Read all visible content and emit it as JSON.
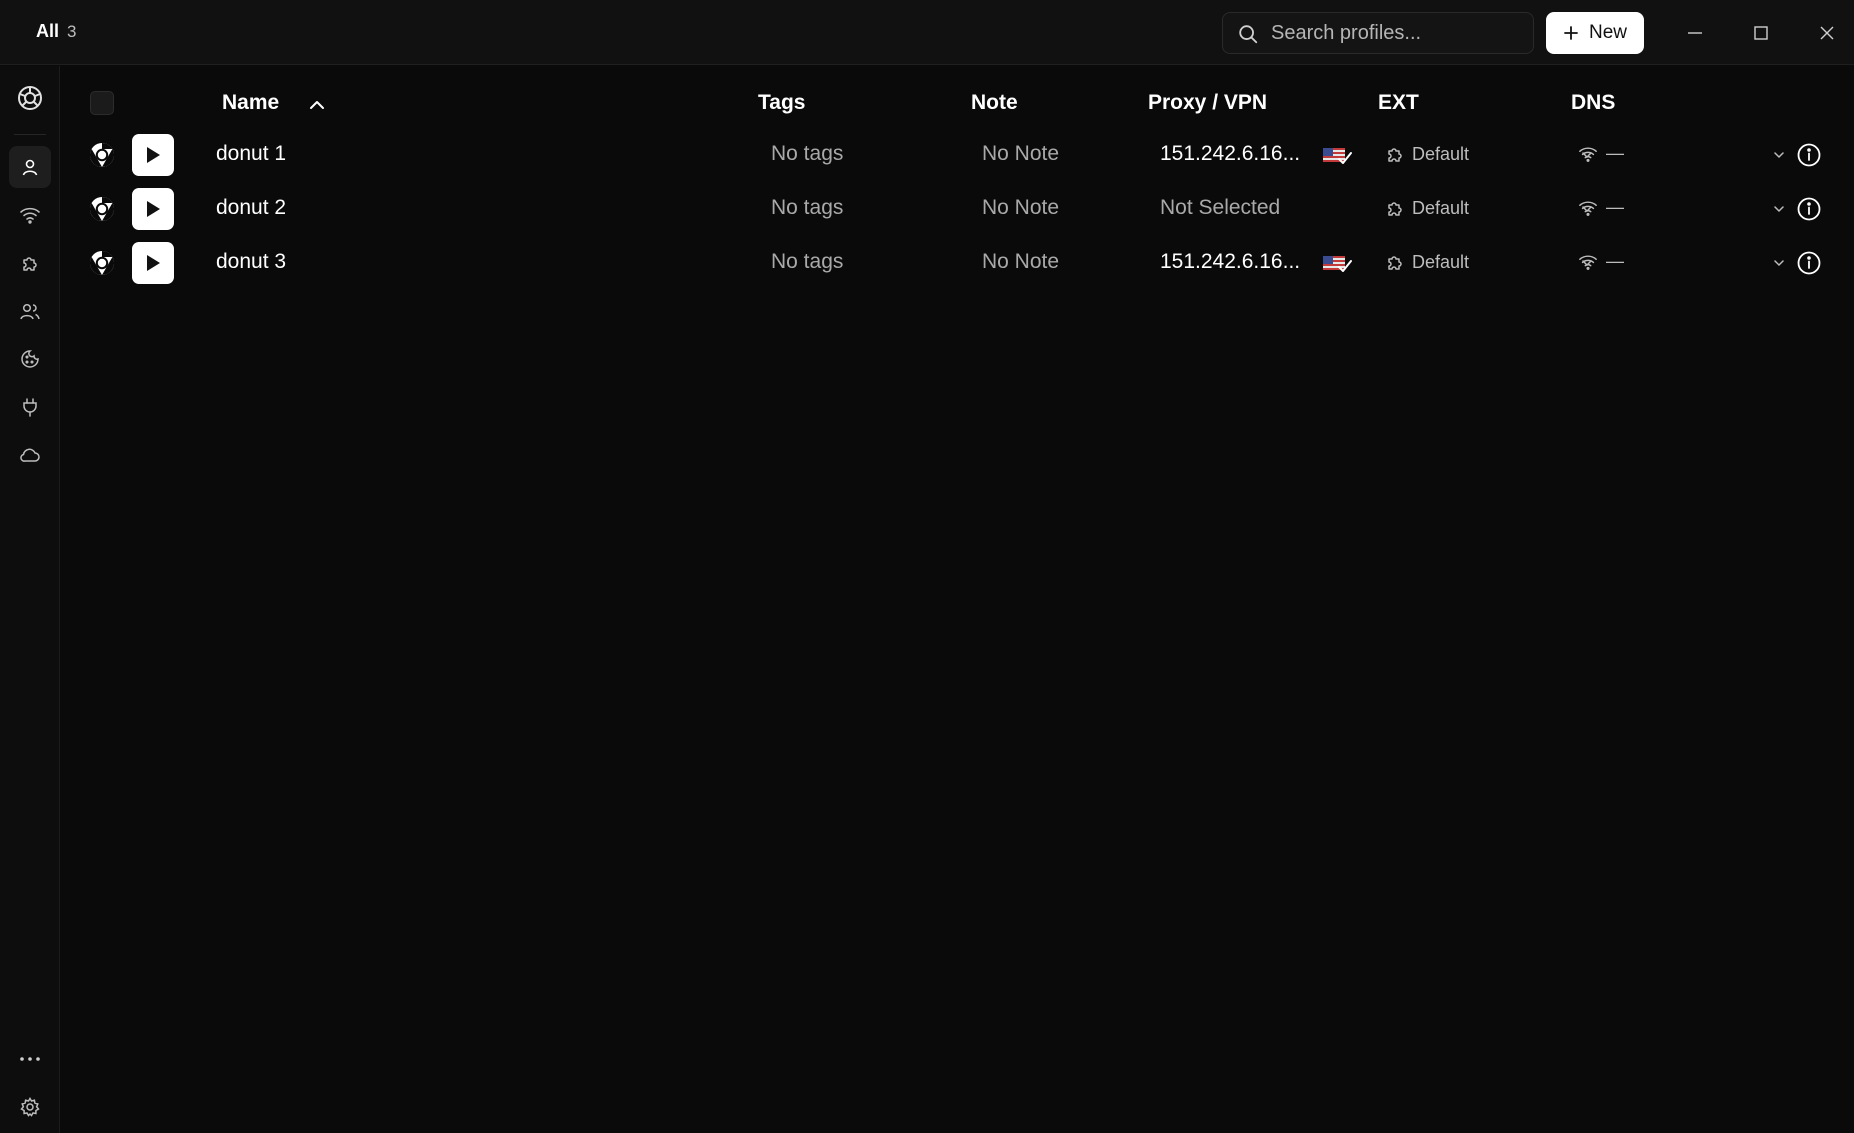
{
  "header": {
    "filter_label": "All",
    "filter_count": "3",
    "search_placeholder": "Search profiles...",
    "new_label": "New"
  },
  "sidebar": {
    "items": [
      {
        "name": "app-logo-icon"
      },
      {
        "name": "profiles-icon",
        "active": true
      },
      {
        "name": "proxy-wifi-icon"
      },
      {
        "name": "extensions-puzzle-icon"
      },
      {
        "name": "team-users-icon"
      },
      {
        "name": "cookies-icon"
      },
      {
        "name": "plug-icon"
      },
      {
        "name": "cloud-icon"
      },
      {
        "name": "more-dots-icon"
      },
      {
        "name": "settings-gear-icon"
      }
    ]
  },
  "table": {
    "columns": [
      "Name",
      "Tags",
      "Note",
      "Proxy / VPN",
      "EXT",
      "DNS"
    ],
    "rows": [
      {
        "name": "donut 1",
        "tags": "No tags",
        "note": "No Note",
        "proxy": "151.242.6.16...",
        "has_flag": true,
        "ext": "Default",
        "dns": "—"
      },
      {
        "name": "donut 2",
        "tags": "No tags",
        "note": "No Note",
        "proxy": "Not Selected",
        "has_flag": false,
        "ext": "Default",
        "dns": "—"
      },
      {
        "name": "donut 3",
        "tags": "No tags",
        "note": "No Note",
        "proxy": "151.242.6.16...",
        "has_flag": true,
        "ext": "Default",
        "dns": "—"
      }
    ]
  },
  "colors": {
    "background": "#0a0a0a",
    "titlebar": "#111111",
    "text_primary": "#ffffff",
    "text_muted": "#a9a9a9",
    "button_bg": "#ffffff"
  }
}
